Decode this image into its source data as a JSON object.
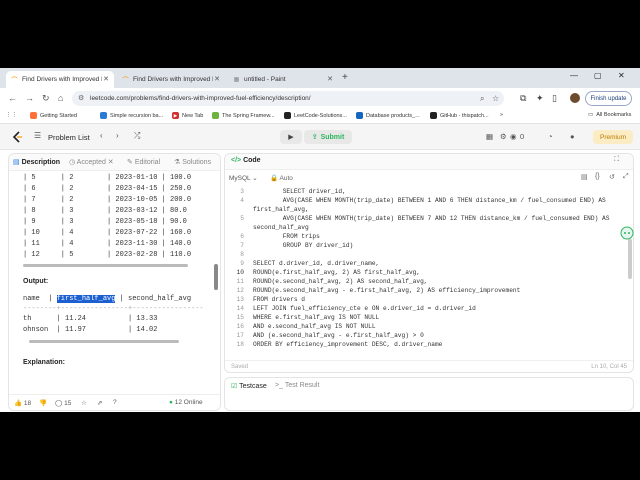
{
  "browser": {
    "tabs": [
      {
        "label": "Find Drivers with Improved Fu",
        "active": true
      },
      {
        "label": "Find Drivers with Improved Fu",
        "active": false
      },
      {
        "label": "untitled - Paint",
        "active": false
      }
    ],
    "url": "leetcode.com/problems/find-drivers-with-improved-fuel-efficiency/description/",
    "finish_update": "Finish update"
  },
  "bookmarks": [
    {
      "label": "Getting Started",
      "color": "#ff7139"
    },
    {
      "label": "Simple recursion ba...",
      "color": "#2b7bd6"
    },
    {
      "label": "New Tab",
      "color": "#d32f2f"
    },
    {
      "label": "The Spring Framew...",
      "color": "#6db33f"
    },
    {
      "label": "LeetCode-Solutions...",
      "color": "#222222"
    },
    {
      "label": "Database products_...",
      "color": "#1565c0"
    },
    {
      "label": "GitHub - thispatch...",
      "color": "#222222"
    }
  ],
  "bookmarks_all": "All Bookmarks",
  "leetcode": {
    "problem_list": "Problem List",
    "submit": "Submit",
    "premium": "Premium",
    "coins": "0"
  },
  "left": {
    "tabs": [
      "Description",
      "Accepted",
      "Editorial",
      "Solutions"
    ],
    "table_rows": [
      "| 5      | 2        | 2023-01-10 | 100.0",
      "| 6      | 2        | 2023-04-15 | 250.0",
      "| 7      | 2        | 2023-10-05 | 200.0",
      "| 8      | 3        | 2023-03-12 | 80.0",
      "| 9      | 3        | 2023-05-18 | 90.0",
      "| 10     | 4        | 2023-07-22 | 160.0",
      "| 11     | 4        | 2023-11-30 | 140.0",
      "| 12     | 5        | 2023-02-28 | 110.0"
    ],
    "output_label": "Output:",
    "out_header_pre": "name  | ",
    "out_header_sel": "first_half_avg",
    "out_header_post": " | second_half_avg",
    "out_sep": "--------+----------------+-----------------",
    "out_rows": [
      "th      | 11.24          | 13.33",
      "ohnson  | 11.97          | 14.02"
    ],
    "explanation": "Explanation:",
    "likes": "18",
    "comments": "15",
    "online": "12 Online"
  },
  "editor": {
    "title": "Code",
    "language": "MySQL",
    "auto": "Auto",
    "saved": "Saved",
    "cursor": "Ln 10, Col 45",
    "lines": [
      {
        "n": "3",
        "t": "        SELECT driver_id,"
      },
      {
        "n": "4",
        "t": "        AVG(CASE WHEN MONTH(trip_date) BETWEEN 1 AND 6 THEN distance_km / fuel_consumed END) AS"
      },
      {
        "n": "",
        "t": "first_half_avg,"
      },
      {
        "n": "5",
        "t": "        AVG(CASE WHEN MONTH(trip_date) BETWEEN 7 AND 12 THEN distance_km / fuel_consumed END) AS"
      },
      {
        "n": "",
        "t": "second_half_avg"
      },
      {
        "n": "6",
        "t": "        FROM trips"
      },
      {
        "n": "7",
        "t": "        GROUP BY driver_id)"
      },
      {
        "n": "8",
        "t": ""
      },
      {
        "n": "9",
        "t": "SELECT d.driver_id, d.driver_name,"
      },
      {
        "n": "10",
        "t": "ROUND(e.first_half_avg, 2) AS first_half_avg,"
      },
      {
        "n": "11",
        "t": "ROUND(e.second_half_avg, 2) AS second_half_avg,"
      },
      {
        "n": "12",
        "t": "ROUND(e.second_half_avg - e.first_half_avg, 2) AS efficiency_improvement"
      },
      {
        "n": "13",
        "t": "FROM drivers d"
      },
      {
        "n": "14",
        "t": "LEFT JOIN fuel_efficiency_cte e ON e.driver_id = d.driver_id"
      },
      {
        "n": "15",
        "t": "WHERE e.first_half_avg IS NOT NULL"
      },
      {
        "n": "16",
        "t": "AND e.second_half_avg IS NOT NULL"
      },
      {
        "n": "17",
        "t": "AND (e.second_half_avg - e.first_half_avg) > 0"
      },
      {
        "n": "18",
        "t": "ORDER BY efficiency_improvement DESC, d.driver_name"
      }
    ]
  },
  "bottom": {
    "testcase": "Testcase",
    "test_result": "Test Result"
  }
}
